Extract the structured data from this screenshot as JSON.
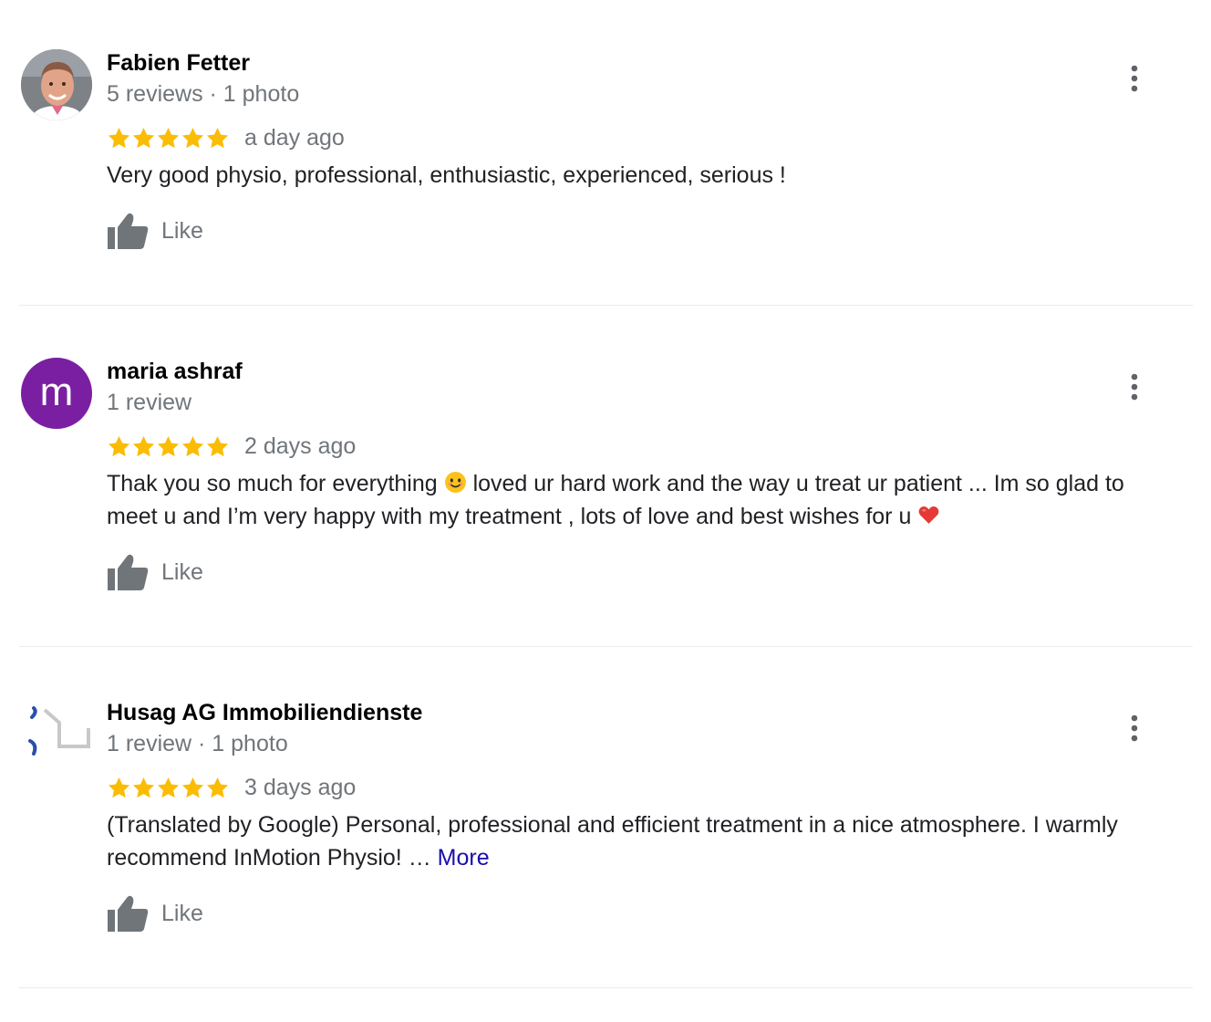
{
  "colors": {
    "star": "#fbbc04",
    "secondary_text": "#70757a",
    "link": "#1a0dab",
    "avatar_m": "#7b1fa2"
  },
  "reviews": [
    {
      "name": "Fabien Fetter",
      "meta": "5 reviews · 1 photo",
      "rating": 5,
      "time": "a day ago",
      "text": "Very good physio, professional, enthusiastic, experienced, serious !",
      "like_label": "Like",
      "avatar": "photo"
    },
    {
      "name": "maria ashraf",
      "meta": "1 review",
      "rating": 5,
      "time": "2 days ago",
      "text_part1": "Thak you so much for everything ",
      "emoji1": "smiling-face-emoji",
      "text_part2": " loved ur hard work and the way u treat ur patient ... Im so glad to meet u and I’m very happy with my treatment , lots of love and best wishes for u ",
      "emoji2": "red-heart-emoji",
      "like_label": "Like",
      "avatar": "m"
    },
    {
      "name": "Husag AG Immobiliendienste",
      "meta": "1 review · 1 photo",
      "rating": 5,
      "time": "3 days ago",
      "text": "(Translated by Google) Personal, professional and efficient treatment in a nice atmosphere. I warmly recommend InMotion Physio! … ",
      "more_label": "More",
      "like_label": "Like",
      "avatar": "logo"
    }
  ]
}
